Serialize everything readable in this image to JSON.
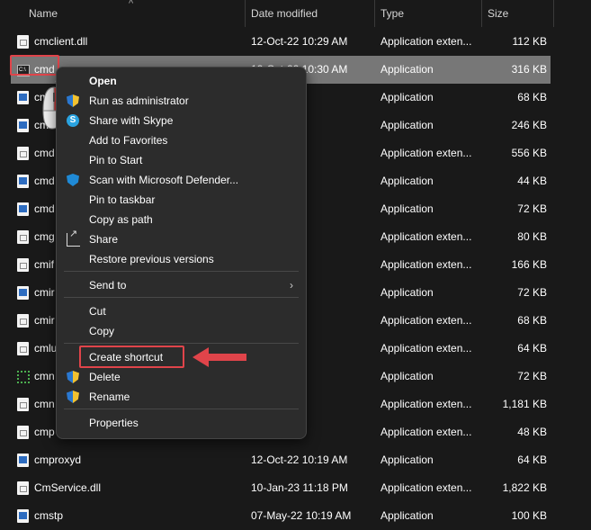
{
  "columns": {
    "name": "Name",
    "date": "Date modified",
    "type": "Type",
    "size": "Size"
  },
  "files": [
    {
      "name": "cmclient.dll",
      "date": "12-Oct-22 10:29 AM",
      "type": "Application exten...",
      "size": "112 KB",
      "icon": "dll-icon"
    },
    {
      "name": "cmd",
      "date": "12-Oct-22 10:30 AM",
      "type": "Application",
      "size": "316 KB",
      "icon": "cmd-icon",
      "selected": true
    },
    {
      "name": "cmd",
      "date": ":30 AM",
      "type": "Application",
      "size": "68 KB",
      "icon": "app-icon"
    },
    {
      "name": "cmd",
      "date": ":29 AM",
      "type": "Application",
      "size": "246 KB",
      "icon": "app-icon"
    },
    {
      "name": "cmd",
      "date": "10:19 AM",
      "type": "Application exten...",
      "size": "556 KB",
      "icon": "dll-icon"
    },
    {
      "name": "cmd",
      "date": "10:19 AM",
      "type": "Application",
      "size": "44 KB",
      "icon": "app-icon"
    },
    {
      "name": "cmd",
      "date": "10:19 AM",
      "type": "Application",
      "size": "72 KB",
      "icon": "app-icon"
    },
    {
      "name": "cmg",
      "date": "10:19 AM",
      "type": "Application exten...",
      "size": "80 KB",
      "icon": "dll-icon"
    },
    {
      "name": "cmif",
      "date": ":24 AM",
      "type": "Application exten...",
      "size": "166 KB",
      "icon": "dll-icon"
    },
    {
      "name": "cmir",
      "date": "2:12 PM",
      "type": "Application",
      "size": "72 KB",
      "icon": "app-icon"
    },
    {
      "name": "cmir",
      "date": ":30 AM",
      "type": "Application exten...",
      "size": "68 KB",
      "icon": "dll-icon"
    },
    {
      "name": "cmlu",
      "date": "10:19 AM",
      "type": "Application exten...",
      "size": "64 KB",
      "icon": "dll-icon"
    },
    {
      "name": "cmn",
      "date": "10:19 AM",
      "type": "Application",
      "size": "72 KB",
      "icon": "network-icon"
    },
    {
      "name": "cmn",
      "date": ":40 AM",
      "type": "Application exten...",
      "size": "1,181 KB",
      "icon": "dll-icon"
    },
    {
      "name": "cmp",
      "date": "10:19 AM",
      "type": "Application exten...",
      "size": "48 KB",
      "icon": "dll-icon"
    },
    {
      "name": "cmproxyd",
      "date": "12-Oct-22 10:19 AM",
      "type": "Application",
      "size": "64 KB",
      "icon": "app-icon"
    },
    {
      "name": "CmService.dll",
      "date": "10-Jan-23 11:18 PM",
      "type": "Application exten...",
      "size": "1,822 KB",
      "icon": "dll-icon"
    },
    {
      "name": "cmstp",
      "date": "07-May-22 10:19 AM",
      "type": "Application",
      "size": "100 KB",
      "icon": "app-icon"
    }
  ],
  "context_menu": {
    "items": [
      {
        "label": "Open",
        "bold": true,
        "icon": ""
      },
      {
        "label": "Run as administrator",
        "icon": "shield-icon"
      },
      {
        "label": "Share with Skype",
        "icon": "skype-icon"
      },
      {
        "label": "Add to Favorites",
        "icon": ""
      },
      {
        "label": "Pin to Start",
        "icon": ""
      },
      {
        "label": "Scan with Microsoft Defender...",
        "icon": "defender-icon"
      },
      {
        "label": "Pin to taskbar",
        "icon": ""
      },
      {
        "label": "Copy as path",
        "icon": ""
      },
      {
        "label": "Share",
        "icon": "share-icon"
      },
      {
        "label": "Restore previous versions",
        "icon": ""
      },
      {
        "label": "Send to",
        "icon": "",
        "submenu": true
      },
      {
        "label": "Cut",
        "icon": ""
      },
      {
        "label": "Copy",
        "icon": ""
      },
      {
        "label": "Create shortcut",
        "icon": "",
        "highlighted": true
      },
      {
        "label": "Delete",
        "icon": "shield-icon"
      },
      {
        "label": "Rename",
        "icon": "shield-icon"
      },
      {
        "label": "Properties",
        "icon": ""
      }
    ]
  },
  "colors": {
    "highlight": "#e0444a",
    "selection": "#777777",
    "menu_bg": "#2c2c2c",
    "window_bg": "#191919"
  }
}
